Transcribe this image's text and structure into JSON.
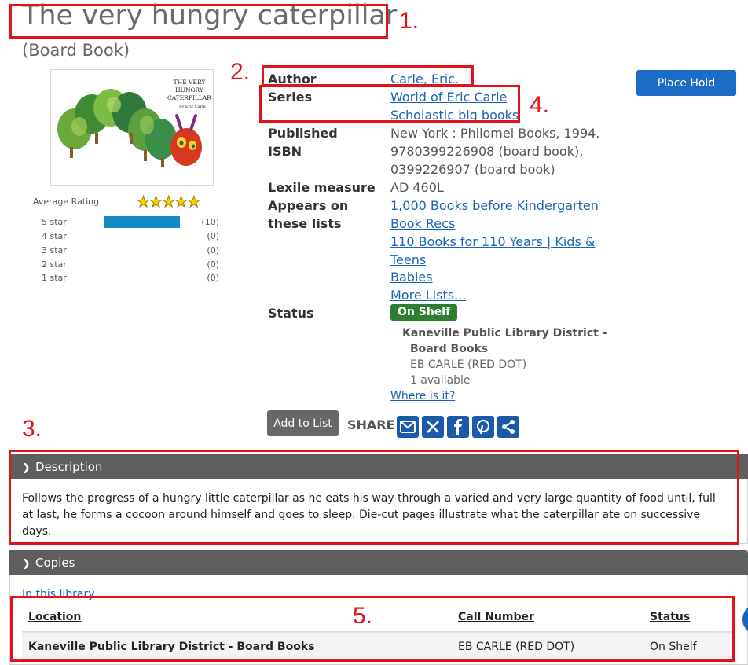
{
  "title": "The very hungry caterpillar",
  "format": "(Board Book)",
  "annotations": [
    "1.",
    "2.",
    "3.",
    "4.",
    "5."
  ],
  "cover": {
    "title_lines": [
      "THE VERY",
      "HUNGRY",
      "CATERPILLAR"
    ],
    "by_line": "by Eric Carle"
  },
  "rating": {
    "label": "Average Rating",
    "stars_filled": 5,
    "rows": [
      {
        "label": "5 star",
        "count": "(10)",
        "fraction": 1.0
      },
      {
        "label": "4 star",
        "count": "(0)",
        "fraction": 0
      },
      {
        "label": "3 star",
        "count": "(0)",
        "fraction": 0
      },
      {
        "label": "2 star",
        "count": "(0)",
        "fraction": 0
      },
      {
        "label": "1 star",
        "count": "(0)",
        "fraction": 0
      }
    ]
  },
  "details": {
    "author_label": "Author",
    "author": "Carle, Eric.",
    "series_label": "Series",
    "series": [
      "World of Eric Carle",
      "Scholastic big books"
    ],
    "published_label": "Published",
    "published": "New York : Philomel Books, 1994.",
    "isbn_label": "ISBN",
    "isbn": [
      "9780399226908 (board book),",
      "0399226907 (board book)"
    ],
    "lexile_label": "Lexile measure",
    "lexile": "AD 460L",
    "lists_label_1": "Appears on",
    "lists_label_2": "these lists",
    "lists": [
      "1,000 Books before Kindergarten",
      "Book Recs",
      "110 Books for 110 Years | Kids &",
      "Teens",
      "Babies",
      "More Lists..."
    ],
    "status_label": "Status",
    "status_badge": "On Shelf",
    "library_line1": "Kaneville Public Library District -",
    "library_line2": "Board Books",
    "call_number": "EB CARLE (RED DOT)",
    "available": "1 available",
    "where_is_it": "Where is it?"
  },
  "actions": {
    "place_hold": "Place Hold",
    "add_to_list": "Add to List",
    "share_label": "SHARE"
  },
  "description": {
    "header": "Description",
    "text": "Follows the progress of a hungry little caterpillar as he eats his way through a varied and very large quantity of food until, full at last, he forms a cocoon around himself and goes to sleep. Die-cut pages illustrate what the caterpillar ate on successive days."
  },
  "copies": {
    "header": "Copies",
    "in_this_library": "In this library",
    "columns": [
      "Location",
      "Call Number",
      "Status"
    ],
    "rows": [
      {
        "location": "Kaneville Public Library District - Board Books",
        "call_number": "EB CARLE (RED DOT)",
        "status": "On Shelf"
      }
    ]
  },
  "colors": {
    "annotation_red": "#e0121a",
    "link_blue": "#1a64b8",
    "status_green": "#2e7d32",
    "panel_header": "#5e5e5e"
  }
}
